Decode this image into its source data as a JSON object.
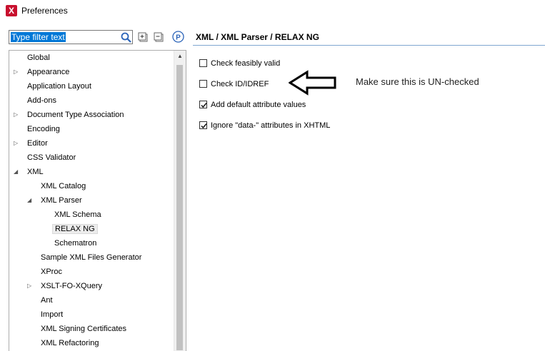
{
  "window": {
    "title": "Preferences",
    "icon": "oxygen-x-icon",
    "icon_letter": "X"
  },
  "filter": {
    "placeholder": "Type filter text"
  },
  "toolbar": {
    "search_icon": "search-icon",
    "expand_icon": "expand-all-icon",
    "collapse_icon": "collapse-all-icon",
    "project_icon": "project-options-icon",
    "project_letter": "P"
  },
  "tree": {
    "items": [
      {
        "label": "Global",
        "expander": ""
      },
      {
        "label": "Appearance",
        "expander": "▷"
      },
      {
        "label": "Application Layout",
        "expander": ""
      },
      {
        "label": "Add-ons",
        "expander": ""
      },
      {
        "label": "Document Type Association",
        "expander": "▷"
      },
      {
        "label": "Encoding",
        "expander": ""
      },
      {
        "label": "Editor",
        "expander": "▷"
      },
      {
        "label": "CSS Validator",
        "expander": ""
      },
      {
        "label": "XML",
        "expander": "◢"
      },
      {
        "label": "XML Catalog",
        "expander": ""
      },
      {
        "label": "XML Parser",
        "expander": "◢"
      },
      {
        "label": "XML Schema",
        "expander": ""
      },
      {
        "label": "RELAX NG",
        "expander": "",
        "selected": true
      },
      {
        "label": "Schematron",
        "expander": ""
      },
      {
        "label": "Sample XML Files Generator",
        "expander": ""
      },
      {
        "label": "XProc",
        "expander": ""
      },
      {
        "label": "XSLT-FO-XQuery",
        "expander": "▷"
      },
      {
        "label": "Ant",
        "expander": ""
      },
      {
        "label": "Import",
        "expander": ""
      },
      {
        "label": "XML Signing Certificates",
        "expander": ""
      },
      {
        "label": "XML Refactoring",
        "expander": ""
      }
    ]
  },
  "page": {
    "title": "XML / XML Parser / RELAX NG",
    "options": [
      {
        "label": "Check feasibly valid",
        "checked": false
      },
      {
        "label": "Check ID/IDREF",
        "checked": false
      },
      {
        "label": "Add default attribute values",
        "checked": true
      },
      {
        "label": "Ignore \"data-\" attributes in XHTML",
        "checked": true
      }
    ]
  },
  "annotation": {
    "text": "Make sure this is UN-checked",
    "arrow_icon": "left-arrow-icon"
  }
}
